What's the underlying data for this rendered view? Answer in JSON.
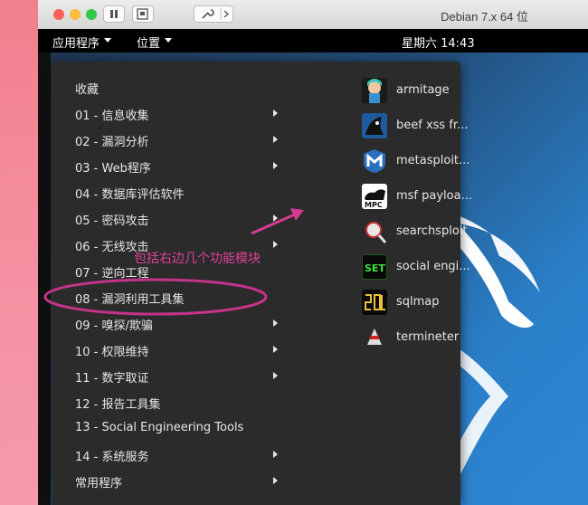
{
  "window": {
    "title": "Debian 7.x 64 位"
  },
  "topbar": {
    "apps_menu": "应用程序",
    "places_menu": "位置",
    "clock": "星期六 14:43"
  },
  "menu": {
    "categories": [
      {
        "label": "收藏",
        "submenu": false
      },
      {
        "label": "01 - 信息收集",
        "submenu": true
      },
      {
        "label": "02 - 漏洞分析",
        "submenu": true
      },
      {
        "label": "03 - Web程序",
        "submenu": true
      },
      {
        "label": "04 - 数据库评估软件",
        "submenu": false
      },
      {
        "label": "05 - 密码攻击",
        "submenu": true
      },
      {
        "label": "06 - 无线攻击",
        "submenu": true
      },
      {
        "label": "07 - 逆向工程",
        "submenu": false
      },
      {
        "label": "08 - 漏洞利用工具集",
        "submenu": false
      },
      {
        "label": "09 - 嗅探/欺骗",
        "submenu": true
      },
      {
        "label": "10 - 权限维持",
        "submenu": true
      },
      {
        "label": "11 - 数字取证",
        "submenu": true
      },
      {
        "label": "12 - 报告工具集",
        "submenu": false
      },
      {
        "label": "13 - Social Engineering Tools",
        "submenu": false
      },
      {
        "label": "14 - 系统服务",
        "submenu": true
      },
      {
        "label": "常用程序",
        "submenu": true
      }
    ],
    "apps": [
      {
        "label": "armitage",
        "icon": "armitage-icon"
      },
      {
        "label": "beef xss fr...",
        "icon": "beef-icon"
      },
      {
        "label": "metasploit...",
        "icon": "metasploit-icon"
      },
      {
        "label": "msf payloa...",
        "icon": "msfpc-icon"
      },
      {
        "label": "searchsploit",
        "icon": "searchsploit-icon"
      },
      {
        "label": "social engi...",
        "icon": "set-icon"
      },
      {
        "label": "sqlmap",
        "icon": "sqlmap-icon"
      },
      {
        "label": "termineter",
        "icon": "termineter-icon"
      }
    ],
    "set_icon_text": "SET",
    "msf_icon_text": "MPC"
  },
  "annotation": {
    "text": "包括右边几个功能模块",
    "color": "#e0409a"
  }
}
